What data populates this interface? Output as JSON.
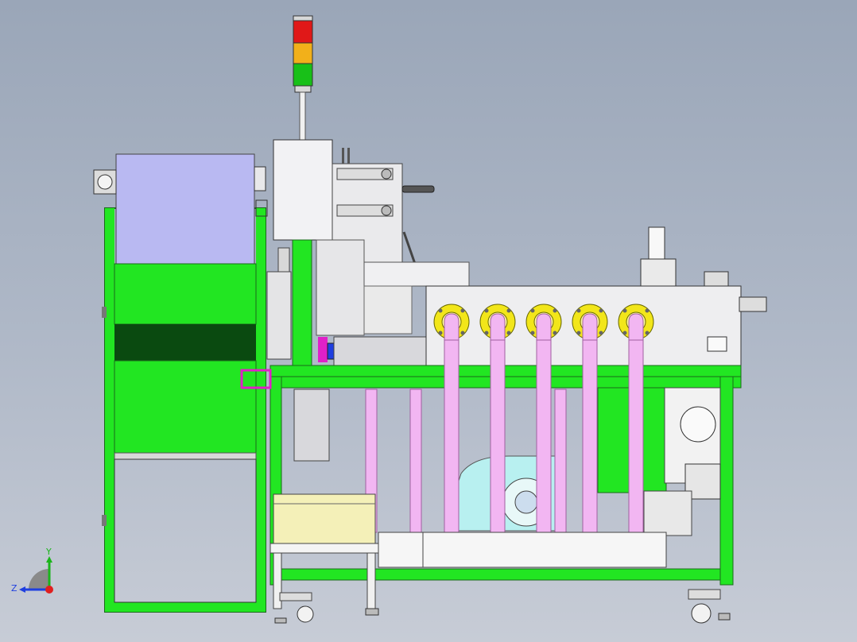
{
  "view": {
    "triad": {
      "y_label": "Y",
      "z_label": "Z",
      "y_color": "#1bb51b",
      "z_color": "#1f3fe0",
      "x_color": "#e01f1f"
    }
  },
  "palette": {
    "frame_green": "#22e622",
    "frame_edge": "#1a6a1a",
    "dark_green_band": "#0a4a10",
    "panel_lavender": "#b9b9f2",
    "pipe_pink": "#f2b6f2",
    "flange_yellow": "#f2e61a",
    "fan_cyan": "#b8f0f0",
    "tray_yellow": "#f4f0b8",
    "machine_grey": "#e8e8ea",
    "magenta_part": "#e020c8",
    "signal_red": "#e01818",
    "signal_amber": "#f2b01a",
    "signal_green": "#18c018"
  },
  "components": {
    "signal_tower": "signal-tower-icon",
    "main_frame": "frame",
    "pipes": "pink-pipes",
    "fan": "blower-fan-icon",
    "casters": "caster-wheel-icon"
  }
}
